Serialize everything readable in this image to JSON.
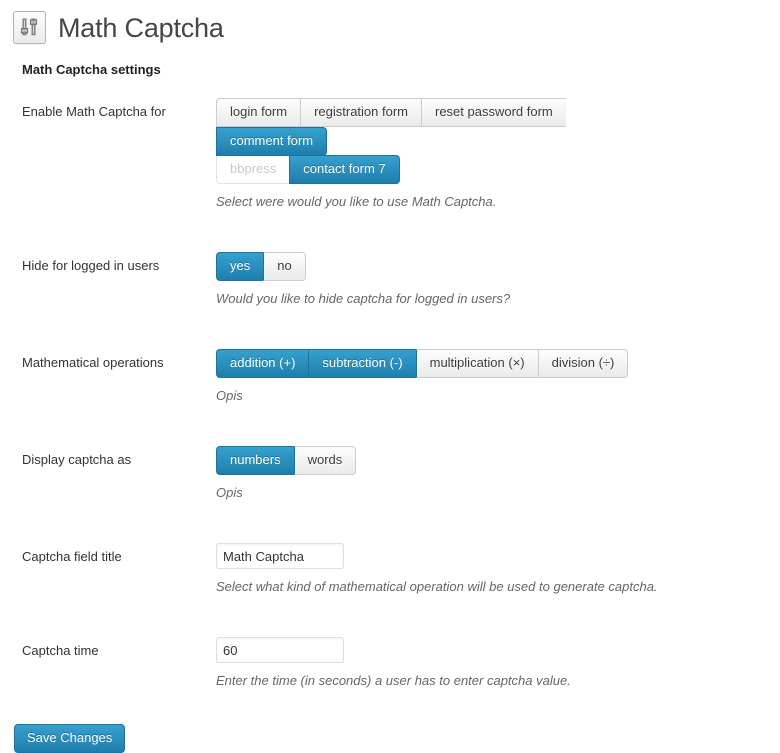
{
  "header": {
    "icon": "sliders-settings-icon",
    "title": "Math Captcha"
  },
  "section": {
    "heading": "Math Captcha settings"
  },
  "colors": {
    "accent_blue": "#2580ac",
    "accent_blue_light": "#35a1cf",
    "button_border": "#cccccc",
    "description_text": "#666666",
    "page_background": "#ffffff"
  },
  "rows": [
    {
      "label": "Enable Math Captcha for",
      "control": "button-group-wrapped",
      "name": "enable-math-captcha-for",
      "options_row1": [
        {
          "label": "login form",
          "active": false,
          "disabled": false
        },
        {
          "label": "registration form",
          "active": false,
          "disabled": false
        },
        {
          "label": "reset password form",
          "active": false,
          "disabled": false
        },
        {
          "label": "comment form",
          "active": true,
          "disabled": false
        }
      ],
      "options_row2": [
        {
          "label": "bbpress",
          "active": false,
          "disabled": true
        },
        {
          "label": "contact form 7",
          "active": true,
          "disabled": false
        }
      ],
      "description": "Select were would you like to use Math Captcha."
    },
    {
      "label": "Hide for logged in users",
      "control": "button-group",
      "name": "hide-for-logged-in-users",
      "options": [
        {
          "label": "yes",
          "active": true,
          "disabled": false
        },
        {
          "label": "no",
          "active": false,
          "disabled": false
        }
      ],
      "description": "Would you like to hide captcha for logged in users?"
    },
    {
      "label": "Mathematical operations",
      "control": "button-group",
      "name": "mathematical-operations",
      "options": [
        {
          "label": "addition (+)",
          "active": true,
          "disabled": false
        },
        {
          "label": "subtraction (-)",
          "active": true,
          "disabled": false
        },
        {
          "label": "multiplication (×)",
          "active": false,
          "disabled": false
        },
        {
          "label": "division (÷)",
          "active": false,
          "disabled": false
        }
      ],
      "description": "Opis"
    },
    {
      "label": "Display captcha as",
      "control": "button-group",
      "name": "display-captcha-as",
      "options": [
        {
          "label": "numbers",
          "active": true,
          "disabled": false
        },
        {
          "label": "words",
          "active": false,
          "disabled": false
        }
      ],
      "description": "Opis"
    },
    {
      "label": "Captcha field title",
      "control": "text-input",
      "name": "captcha-field-title",
      "value": "Math Captcha",
      "placeholder": "",
      "description": "Select what kind of mathematical operation will be used to generate captcha."
    },
    {
      "label": "Captcha time",
      "control": "text-input",
      "name": "captcha-time",
      "value": "60",
      "placeholder": "",
      "description": "Enter the time (in seconds) a user has to enter captcha value."
    }
  ],
  "submit": {
    "save_label": "Save Changes"
  }
}
